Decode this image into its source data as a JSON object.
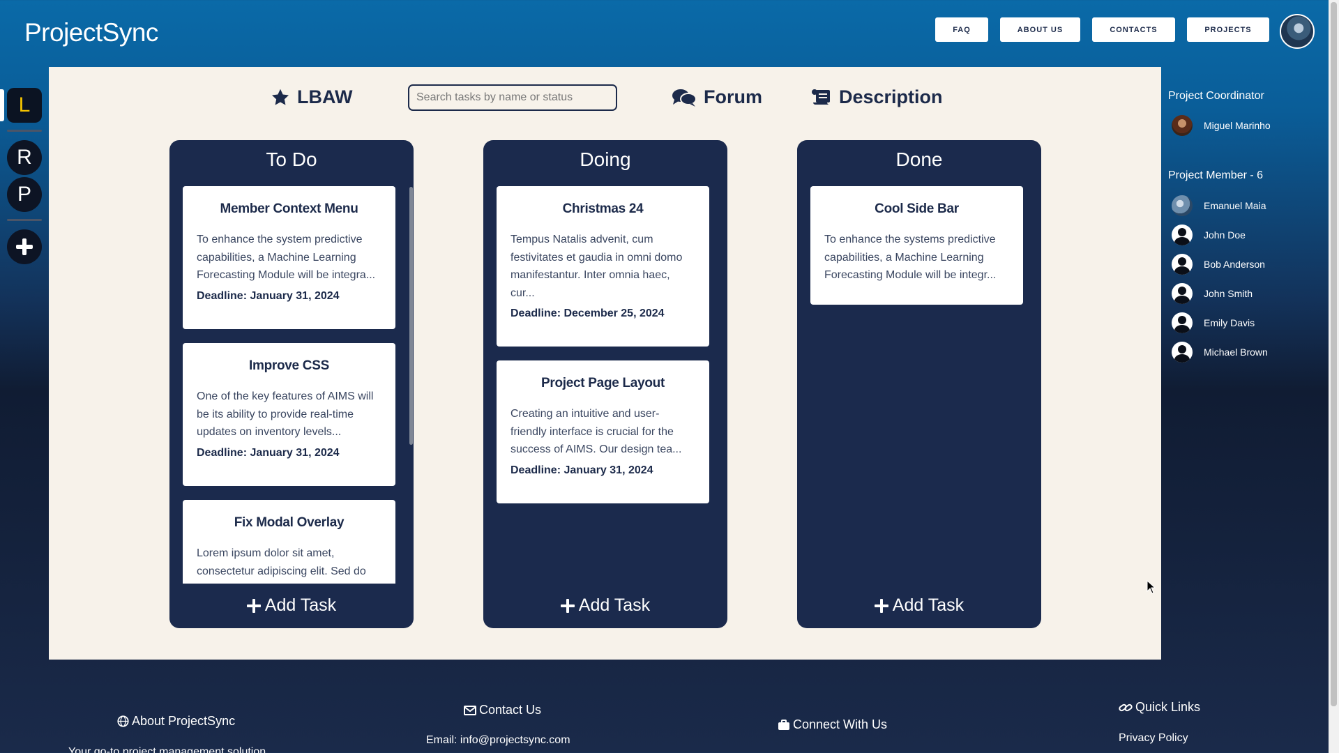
{
  "brand": "ProjectSync",
  "nav": {
    "faq": "FAQ",
    "about": "ABOUT US",
    "contacts": "CONTACTS",
    "projects": "PROJECTS"
  },
  "rail": {
    "items": [
      {
        "label": "L",
        "active": true
      },
      {
        "label": "R",
        "active": false
      },
      {
        "label": "P",
        "active": false
      }
    ]
  },
  "toolbar": {
    "project_name": "LBAW",
    "search_placeholder": "Search tasks by name or status",
    "forum": "Forum",
    "description": "Description"
  },
  "columns": [
    {
      "title": "To Do",
      "add_label": "Add Task",
      "cards": [
        {
          "title": "Member Context Menu",
          "desc": "To enhance the system predictive capabilities, a Machine Learning Forecasting Module will be integra...",
          "deadline": "Deadline: January 31, 2024"
        },
        {
          "title": "Improve CSS",
          "desc": "One of the key features of AIMS will be its ability to provide real-time updates on inventory levels...",
          "deadline": "Deadline: January 31, 2024"
        },
        {
          "title": "Fix Modal Overlay",
          "desc": "Lorem ipsum dolor sit amet, consectetur adipiscing elit. Sed do",
          "deadline": ""
        }
      ]
    },
    {
      "title": "Doing",
      "add_label": "Add Task",
      "cards": [
        {
          "title": "Christmas 24",
          "desc": "Tempus Natalis advenit, cum festivitates et gaudia in omni domo manifestantur. Inter omnia haec, cur...",
          "deadline": "Deadline: December 25, 2024"
        },
        {
          "title": "Project Page Layout",
          "desc": "Creating an intuitive and user-friendly interface is crucial for the success of AIMS. Our design tea...",
          "deadline": "Deadline: January 31, 2024"
        }
      ]
    },
    {
      "title": "Done",
      "add_label": "Add Task",
      "cards": [
        {
          "title": "Cool Side Bar",
          "desc": "To enhance the systems predictive capabilities, a Machine Learning Forecasting Module will be integr...",
          "deadline": ""
        }
      ]
    }
  ],
  "sidebar": {
    "coordinator_heading": "Project Coordinator",
    "coordinator": "Miguel Marinho",
    "members_heading": "Project Member - 6",
    "members": [
      "Emanuel Maia",
      "John Doe",
      "Bob Anderson",
      "John Smith",
      "Emily Davis",
      "Michael Brown"
    ]
  },
  "footer": {
    "about_heading": "About ProjectSync",
    "about_text": "Your go-to project management solution",
    "contact_heading": "Contact Us",
    "contact_email": "Email: info@projectsync.com",
    "connect_heading": "Connect With Us",
    "links_heading": "Quick Links",
    "privacy": "Privacy Policy"
  },
  "icons": {
    "star": "star-icon",
    "forum": "comments-icon",
    "description": "scroll-icon",
    "plus": "plus-icon",
    "globe": "globe-icon",
    "envelope": "envelope-icon",
    "briefcase": "briefcase-icon",
    "link": "link-icon"
  }
}
